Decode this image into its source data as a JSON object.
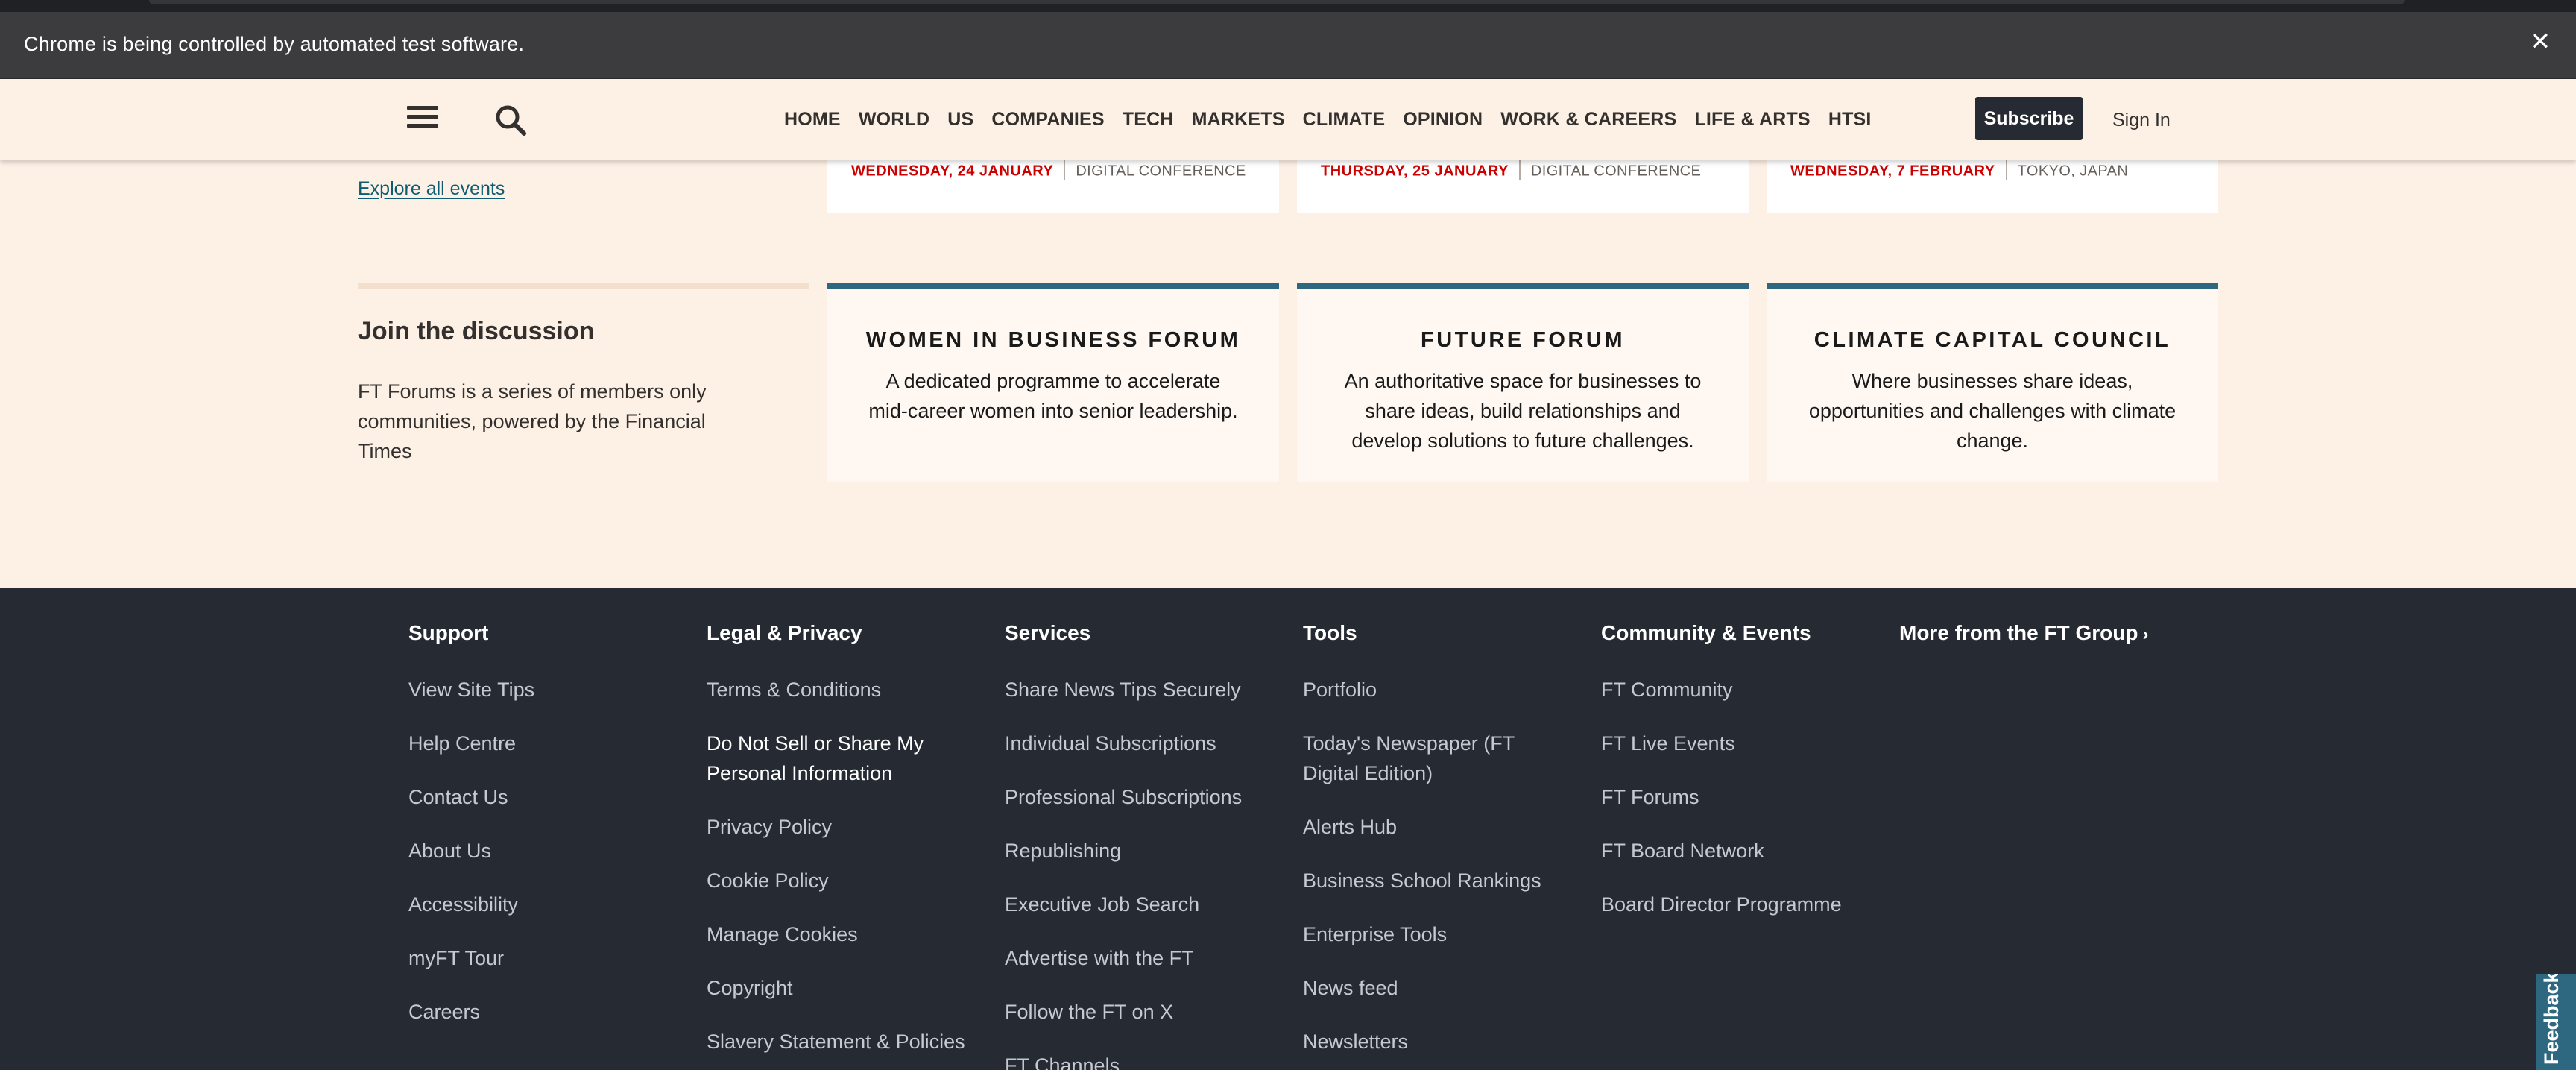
{
  "browser": {
    "infobar_message": "Chrome is being controlled by automated test software.",
    "close_glyph": "✕"
  },
  "header": {
    "nav": [
      "HOME",
      "WORLD",
      "US",
      "COMPANIES",
      "TECH",
      "MARKETS",
      "CLIMATE",
      "OPINION",
      "WORK & CAREERS",
      "LIFE & ARTS",
      "HTSI"
    ],
    "subscribe_label": "Subscribe",
    "signin_label": "Sign In",
    "icons": [
      "menu-icon",
      "search-icon"
    ]
  },
  "events": {
    "explore_label": "Explore all events",
    "cards": [
      {
        "date": "WEDNESDAY, 24 JANUARY",
        "type": "DIGITAL CONFERENCE"
      },
      {
        "date": "THURSDAY, 25 JANUARY",
        "type": "DIGITAL CONFERENCE"
      },
      {
        "date": "WEDNESDAY, 7 FEBRUARY",
        "type": "TOKYO, JAPAN"
      }
    ]
  },
  "discussion": {
    "title": "Join the discussion",
    "description": "FT Forums is a series of members only communities, powered by the Financial Times",
    "forums": [
      {
        "title": "WOMEN IN BUSINESS FORUM",
        "description": "A dedicated programme to accelerate mid-career women into senior leadership."
      },
      {
        "title": "FUTURE FORUM",
        "description": "An authoritative space for businesses to share ideas, build relationships and develop solutions to future challenges."
      },
      {
        "title": "CLIMATE CAPITAL COUNCIL",
        "description": "Where businesses share ideas, opportunities and challenges with climate change."
      }
    ]
  },
  "footer": {
    "columns": [
      {
        "heading": "Support",
        "links": [
          "View Site Tips",
          "Help Centre",
          "Contact Us",
          "About Us",
          "Accessibility",
          "myFT Tour",
          "Careers"
        ]
      },
      {
        "heading": "Legal & Privacy",
        "links": [
          "Terms & Conditions",
          "Do Not Sell or Share My Personal Information",
          "Privacy Policy",
          "Cookie Policy",
          "Manage Cookies",
          "Copyright",
          "Slavery Statement & Policies"
        ]
      },
      {
        "heading": "Services",
        "links": [
          "Share News Tips Securely",
          "Individual Subscriptions",
          "Professional Subscriptions",
          "Republishing",
          "Executive Job Search",
          "Advertise with the FT",
          "Follow the FT on X",
          "FT Channels"
        ]
      },
      {
        "heading": "Tools",
        "links": [
          "Portfolio",
          "Today's Newspaper (FT Digital Edition)",
          "Alerts Hub",
          "Business School Rankings",
          "Enterprise Tools",
          "News feed",
          "Newsletters"
        ]
      },
      {
        "heading": "Community & Events",
        "links": [
          "FT Community",
          "FT Live Events",
          "FT Forums",
          "FT Board Network",
          "Board Director Programme"
        ]
      }
    ],
    "more_label": "More from the FT Group",
    "more_chevron": "›"
  },
  "feedback_label": "Feedback",
  "colors": {
    "page_bg": "#fdf1e6",
    "footer_bg": "#262a33",
    "accent_teal": "#2e6880",
    "event_date_red": "#cc0000",
    "link_teal": "#0d5c73"
  }
}
